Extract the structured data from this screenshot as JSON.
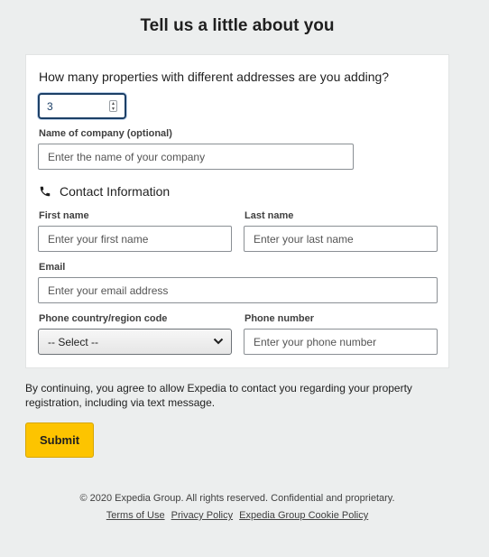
{
  "page_title": "Tell us a little about you",
  "properties": {
    "question": "How many properties with different addresses are you adding?",
    "value": "3"
  },
  "company": {
    "label": "Name of company (optional)",
    "placeholder": "Enter the name of your company"
  },
  "contact": {
    "heading": "Contact Information",
    "icon": "phone-icon",
    "first_name": {
      "label": "First name",
      "placeholder": "Enter your first name"
    },
    "last_name": {
      "label": "Last name",
      "placeholder": "Enter your last name"
    },
    "email": {
      "label": "Email",
      "placeholder": "Enter your email address"
    },
    "country_code": {
      "label": "Phone country/region code",
      "selected": "-- Select --"
    },
    "phone": {
      "label": "Phone number",
      "placeholder": "Enter your phone number"
    }
  },
  "consent_text": "By continuing, you agree to allow Expedia to contact you regarding your property registration, including via text message.",
  "submit_label": "Submit",
  "footer": {
    "copyright": "© 2020 Expedia Group. All rights reserved. Confidential and proprietary.",
    "links": [
      "Terms of Use",
      "Privacy Policy",
      "Expedia Group Cookie Policy"
    ]
  },
  "colors": {
    "accent": "#fdc400",
    "focus": "#1c3f66",
    "background": "#eceeee"
  }
}
